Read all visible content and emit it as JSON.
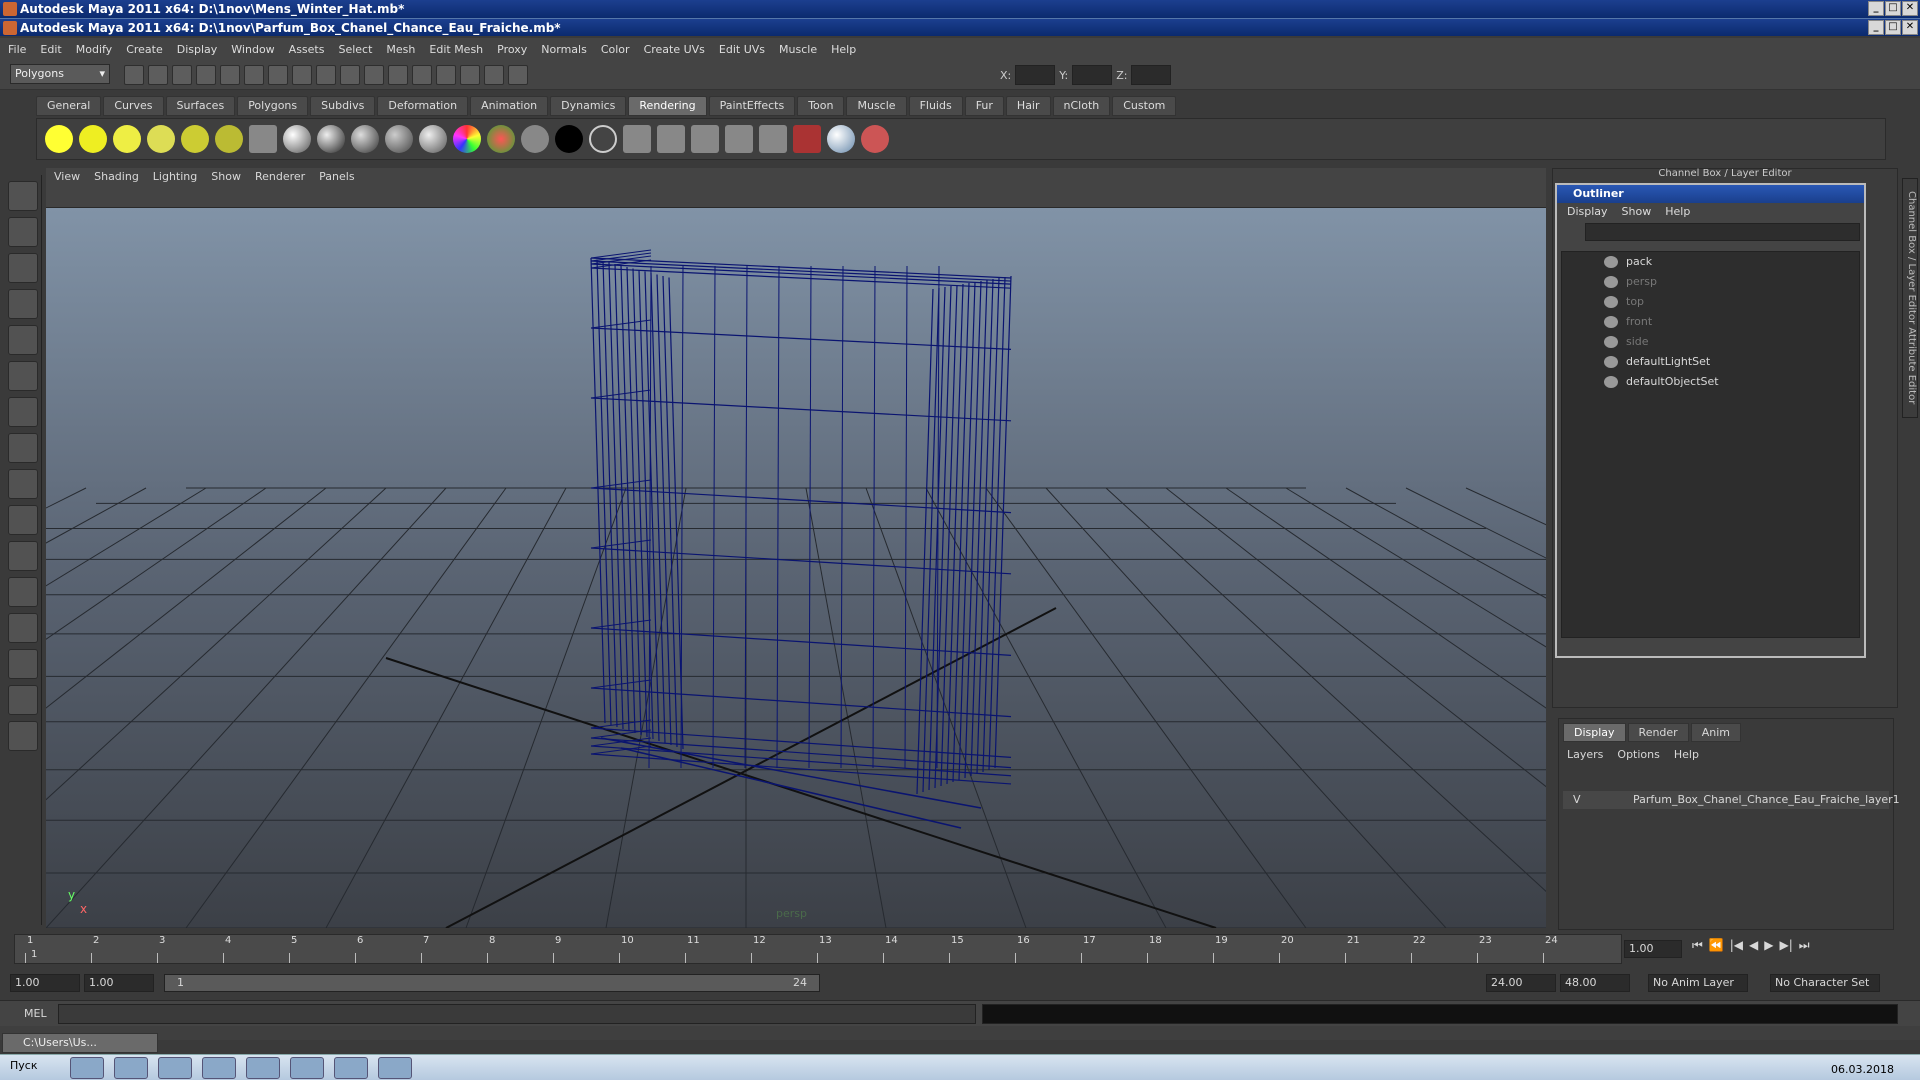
{
  "window": {
    "title_back": "Autodesk Maya 2011 x64: D:\\1nov\\Mens_Winter_Hat.mb*",
    "title_front": "Autodesk Maya 2011 x64: D:\\1nov\\Parfum_Box_Chanel_Chance_Eau_Fraiche.mb*"
  },
  "menubar": [
    "File",
    "Edit",
    "Modify",
    "Create",
    "Display",
    "Window",
    "Assets",
    "Select",
    "Mesh",
    "Edit Mesh",
    "Proxy",
    "Normals",
    "Color",
    "Create UVs",
    "Edit UVs",
    "Muscle",
    "Help"
  ],
  "statusline": {
    "mode": "Polygons",
    "x_label": "X:",
    "y_label": "Y:",
    "z_label": "Z:"
  },
  "shelf_tabs": [
    "General",
    "Curves",
    "Surfaces",
    "Polygons",
    "Subdivs",
    "Deformation",
    "Animation",
    "Dynamics",
    "Rendering",
    "PaintEffects",
    "Toon",
    "Muscle",
    "Fluids",
    "Fur",
    "Hair",
    "nCloth",
    "Custom"
  ],
  "shelf_active": "Rendering",
  "viewport": {
    "menu": [
      "View",
      "Shading",
      "Lighting",
      "Show",
      "Renderer",
      "Panels"
    ],
    "camera_label": "persp",
    "axis_y": "y",
    "axis_x": "x"
  },
  "right_panel": {
    "title": "Channel Box / Layer Editor",
    "side_tabs": "Channel Box / Layer Editor    Attribute Editor"
  },
  "outliner": {
    "title": "Outliner",
    "menu": [
      "Display",
      "Show",
      "Help"
    ],
    "items": [
      {
        "label": "pack",
        "dim": false
      },
      {
        "label": "persp",
        "dim": true
      },
      {
        "label": "top",
        "dim": true
      },
      {
        "label": "front",
        "dim": true
      },
      {
        "label": "side",
        "dim": true
      },
      {
        "label": "defaultLightSet",
        "dim": false
      },
      {
        "label": "defaultObjectSet",
        "dim": false
      }
    ]
  },
  "layer_editor": {
    "tabs": [
      "Display",
      "Render",
      "Anim"
    ],
    "menu": [
      "Layers",
      "Options",
      "Help"
    ],
    "layer_visible": "V",
    "layer_name": "Parfum_Box_Chanel_Chance_Eau_Fraiche_layer1"
  },
  "timeline": {
    "ticks": [
      "1",
      "2",
      "3",
      "4",
      "5",
      "6",
      "7",
      "8",
      "9",
      "10",
      "11",
      "12",
      "13",
      "14",
      "15",
      "16",
      "17",
      "18",
      "19",
      "20",
      "21",
      "22",
      "23",
      "24"
    ],
    "current_frame_marker": "1",
    "current_time": "1.00"
  },
  "range": {
    "start": "1.00",
    "playback_start": "1.00",
    "bar_start": "1",
    "bar_end": "24",
    "playback_end": "24.00",
    "end": "48.00",
    "anim_layer": "No Anim Layer",
    "char_set": "No Character Set"
  },
  "cmdline": {
    "label": "MEL"
  },
  "minimized": {
    "label": "C:\\Users\\Us..."
  },
  "taskbar": {
    "lang": "Пуск",
    "date": "06.03.2018"
  },
  "colors": {
    "wireframe": "#0a1470",
    "accent": "#1a3f8c"
  }
}
